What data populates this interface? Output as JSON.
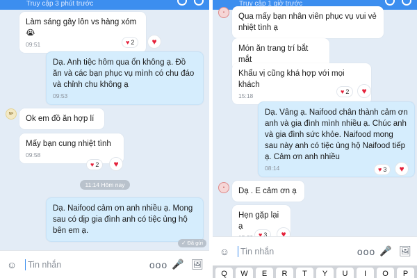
{
  "left": {
    "status": "Truy cập 3 phút trước",
    "messages": [
      {
        "text": "Làm sáng gây lôn vs hàng xóm 😭",
        "time": "09:51",
        "reaction_count": "2"
      },
      {
        "text": "Dạ. Anh tiệc hôm qua ổn không ạ. Đồ ăn và các bạn phục vụ mình có chu đáo và chỉnh chu không ạ",
        "time": "09:53"
      },
      {
        "text": "Ok em đồ ăn hợp lí"
      },
      {
        "text": "Mấy bạn cung nhiệt tình",
        "time": "09:58",
        "reaction_count": "2"
      },
      {
        "text": "Dạ. Naifood cảm ơn anh nhiều ạ. Mong sau có dịp gia đình anh có tiệc ủng hộ bên em ạ."
      }
    ],
    "date_divider": "11:14 Hôm nay",
    "seen": "✓ Đã gửi",
    "composer_placeholder": "Tin nhắn"
  },
  "right": {
    "status": "Truy cập 1 giờ trước",
    "messages": [
      {
        "text": "Qua mấy bạn nhân viên phục vụ vui vẻ nhiệt tình ạ"
      },
      {
        "text": "Món ăn trang trí bắt mắt"
      },
      {
        "text": "Khẩu vị cũng khá hợp với mọi khách",
        "time": "15:18",
        "reaction_count": "2"
      },
      {
        "text": "Dạ. Vâng ạ. Naifood chân thành cảm ơn anh và gia đình mình nhiều ạ. Chúc anh và gia đình sức khỏe. Naifood mong sau này anh có tiệc ủng hộ Naifood tiếp ạ. Cảm ơn anh nhiều",
        "time": "08:14",
        "reaction_count": "3"
      },
      {
        "text": "Dạ . E cảm ơn ạ"
      },
      {
        "text": "Hẹn gặp lại ạ",
        "time": "15:29",
        "reaction_count": "3"
      }
    ],
    "composer_placeholder": "Tin nhắn",
    "keyboard_row": [
      "Q",
      "W",
      "E",
      "R",
      "T",
      "Y",
      "U",
      "I",
      "O",
      "P"
    ]
  },
  "icons": {
    "heart": "♥",
    "sticker": "☺",
    "more": "ooo",
    "mic": "🎤",
    "image": "🖼"
  },
  "colors": {
    "accent": "#3c8eef",
    "chat_bg": "#e3ecf6",
    "my_bubble": "#d5edfd",
    "their_bubble": "#ffffff",
    "reaction": "#e5213a"
  }
}
